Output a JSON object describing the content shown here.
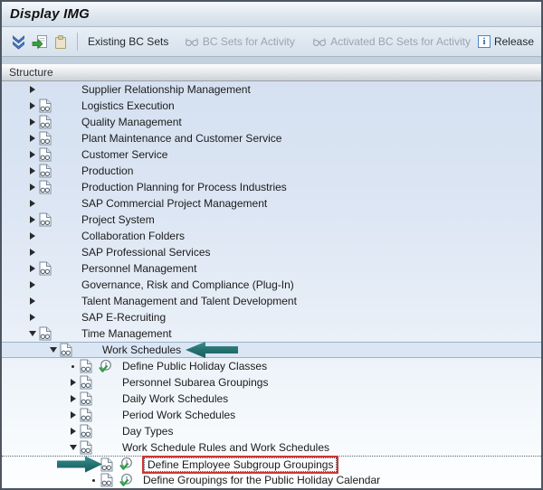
{
  "window": {
    "title": "Display IMG"
  },
  "toolbar": {
    "icon_buttons": [
      {
        "name": "expand-collapse",
        "enabled": true
      },
      {
        "name": "display-bc-sets",
        "enabled": true
      },
      {
        "name": "copy",
        "enabled": false
      }
    ],
    "buttons": [
      {
        "label": "Existing BC Sets",
        "enabled": true,
        "icon": "none"
      },
      {
        "label": "BC Sets for Activity",
        "enabled": false,
        "icon": "glasses"
      },
      {
        "label": "Activated BC Sets for Activity",
        "enabled": false,
        "icon": "glasses"
      },
      {
        "label": "Release",
        "enabled": true,
        "icon": "info"
      }
    ]
  },
  "structure_header": "Structure",
  "colors": {
    "annotation_arrow": "#236f6e",
    "highlight_box": "#cd3732",
    "tree_top": "#d5e1f1",
    "tree_bottom": "#fdfeff"
  },
  "tree": {
    "rows": [
      {
        "label": "Supplier Relationship Management",
        "level": 1,
        "expander": "collapsed",
        "doc": false,
        "activity": false
      },
      {
        "label": "Logistics Execution",
        "level": 1,
        "expander": "collapsed",
        "doc": true,
        "activity": false
      },
      {
        "label": "Quality Management",
        "level": 1,
        "expander": "collapsed",
        "doc": true,
        "activity": false
      },
      {
        "label": "Plant Maintenance and Customer Service",
        "level": 1,
        "expander": "collapsed",
        "doc": true,
        "activity": false
      },
      {
        "label": "Customer Service",
        "level": 1,
        "expander": "collapsed",
        "doc": true,
        "activity": false
      },
      {
        "label": "Production",
        "level": 1,
        "expander": "collapsed",
        "doc": true,
        "activity": false
      },
      {
        "label": "Production Planning for Process Industries",
        "level": 1,
        "expander": "collapsed",
        "doc": true,
        "activity": false
      },
      {
        "label": "SAP Commercial Project Management",
        "level": 1,
        "expander": "collapsed",
        "doc": false,
        "activity": false
      },
      {
        "label": "Project System",
        "level": 1,
        "expander": "collapsed",
        "doc": true,
        "activity": false
      },
      {
        "label": "Collaboration Folders",
        "level": 1,
        "expander": "collapsed",
        "doc": false,
        "activity": false
      },
      {
        "label": "SAP Professional Services",
        "level": 1,
        "expander": "collapsed",
        "doc": false,
        "activity": false
      },
      {
        "label": "Personnel Management",
        "level": 1,
        "expander": "collapsed",
        "doc": true,
        "activity": false
      },
      {
        "label": "Governance, Risk and Compliance (Plug-In)",
        "level": 1,
        "expander": "collapsed",
        "doc": false,
        "activity": false
      },
      {
        "label": "Talent Management and Talent Development",
        "level": 1,
        "expander": "collapsed",
        "doc": false,
        "activity": false
      },
      {
        "label": "SAP E-Recruiting",
        "level": 1,
        "expander": "collapsed",
        "doc": false,
        "activity": false
      },
      {
        "label": "Time Management",
        "level": 1,
        "expander": "expanded",
        "doc": true,
        "activity": false
      },
      {
        "label": "Work Schedules",
        "level": 2,
        "expander": "expanded",
        "doc": true,
        "activity": false,
        "selected_band": true,
        "annotation": "arrow-left"
      },
      {
        "label": "Define Public Holiday Classes",
        "level": 3,
        "expander": "leaf",
        "doc": true,
        "activity": true
      },
      {
        "label": "Personnel Subarea Groupings",
        "level": 3,
        "expander": "collapsed",
        "doc": true,
        "activity": false
      },
      {
        "label": "Daily Work Schedules",
        "level": 3,
        "expander": "collapsed",
        "doc": true,
        "activity": false
      },
      {
        "label": "Period Work Schedules",
        "level": 3,
        "expander": "collapsed",
        "doc": true,
        "activity": false
      },
      {
        "label": "Day Types",
        "level": 3,
        "expander": "collapsed",
        "doc": true,
        "activity": false
      },
      {
        "label": "Work Schedule Rules and Work Schedules",
        "level": 3,
        "expander": "expanded",
        "doc": true,
        "activity": false
      },
      {
        "label": "Define Employee Subgroup Groupings",
        "level": 4,
        "expander": "none",
        "doc": true,
        "activity": true,
        "focus": true,
        "red_box": true,
        "annotation": "arrow-right"
      },
      {
        "label": "Define Groupings for the Public Holiday Calendar",
        "level": 4,
        "expander": "leaf",
        "doc": true,
        "activity": true
      }
    ]
  }
}
